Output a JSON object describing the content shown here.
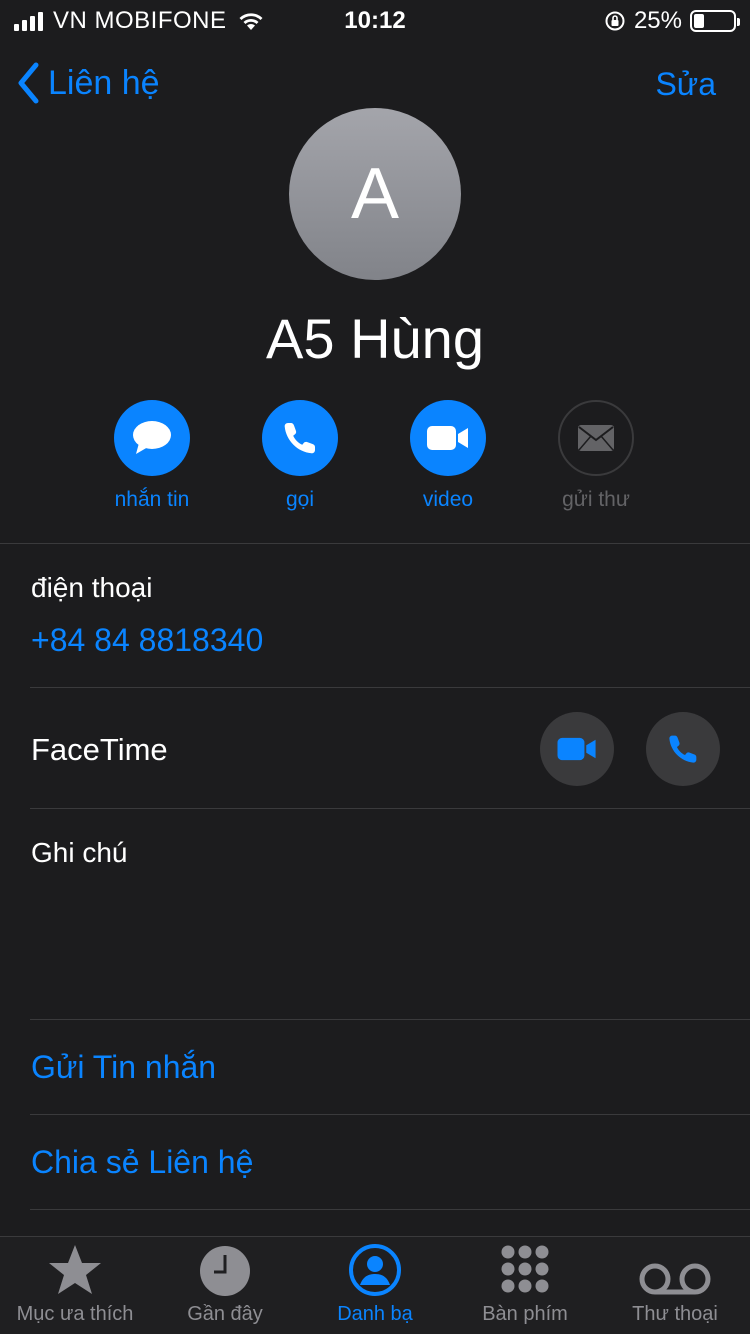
{
  "status": {
    "carrier": "VN MOBIFONE",
    "time": "10:12",
    "battery_text": "25%",
    "battery_level": 0.25
  },
  "nav": {
    "back_label": "Liên hệ",
    "edit_label": "Sửa"
  },
  "contact": {
    "initial": "A",
    "name": "A5 Hùng"
  },
  "actions": [
    {
      "label": "nhắn tin",
      "icon": "message-icon",
      "enabled": true
    },
    {
      "label": "gọi",
      "icon": "phone-icon",
      "enabled": true
    },
    {
      "label": "video",
      "icon": "video-icon",
      "enabled": true
    },
    {
      "label": "gửi thư",
      "icon": "mail-icon",
      "enabled": false
    }
  ],
  "phone": {
    "label": "điện thoại",
    "value": "+84 84 8818340"
  },
  "facetime": {
    "label": "FaceTime"
  },
  "notes": {
    "label": "Ghi chú"
  },
  "links": {
    "send_message": "Gửi Tin nhắn",
    "share_contact": "Chia sẻ Liên hệ"
  },
  "tabs": [
    {
      "label": "Mục ưa thích",
      "icon": "star-icon",
      "active": false
    },
    {
      "label": "Gần đây",
      "icon": "clock-icon",
      "active": false
    },
    {
      "label": "Danh bạ",
      "icon": "contacts-icon",
      "active": true
    },
    {
      "label": "Bàn phím",
      "icon": "keypad-icon",
      "active": false
    },
    {
      "label": "Thư thoại",
      "icon": "voicemail-icon",
      "active": false
    }
  ],
  "colors": {
    "accent": "#0a84ff",
    "background": "#1c1c1e",
    "separator": "#3a3a3c",
    "inactive": "#8e8e93"
  }
}
